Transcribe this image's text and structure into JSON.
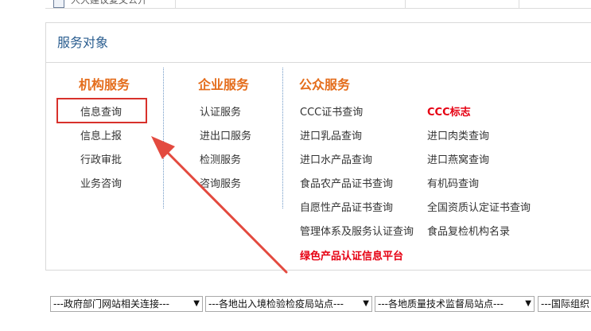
{
  "top_row": {
    "text": "人大建议复文公开"
  },
  "panel": {
    "title": "服务对象",
    "columns": [
      {
        "heading": "机构服务",
        "items": [
          "信息查询",
          "信息上报",
          "行政审批",
          "业务咨询"
        ]
      },
      {
        "heading": "企业服务",
        "items": [
          "认证服务",
          "进出口服务",
          "检测服务",
          "咨询服务"
        ]
      },
      {
        "heading": "公众服务",
        "left_items": [
          "CCC证书查询",
          "进口乳品查询",
          "进口水产品查询",
          "食品农产品证书查询",
          "自愿性产品证书查询",
          "管理体系及服务认证查询",
          "绿色产品认证信息平台"
        ],
        "right_items": [
          "CCC标志",
          "进口肉类查询",
          "进口燕窝查询",
          "有机码查询",
          "全国资质认定证书查询",
          "食品复检机构名录"
        ]
      }
    ],
    "highlighted_item": "信息查询"
  },
  "selects": [
    {
      "value": "---政府部门网站相关连接---"
    },
    {
      "value": "---各地出入境检验检疫局站点---"
    },
    {
      "value": "---各地质量技术监督局站点---"
    },
    {
      "value": "---国际组织"
    }
  ],
  "colors": {
    "heading": "#e46d1c",
    "title": "#2a5d8f",
    "emphasis": "#e60012",
    "annotation": "#d8312b"
  },
  "icons": {
    "select_caret": "▼"
  }
}
